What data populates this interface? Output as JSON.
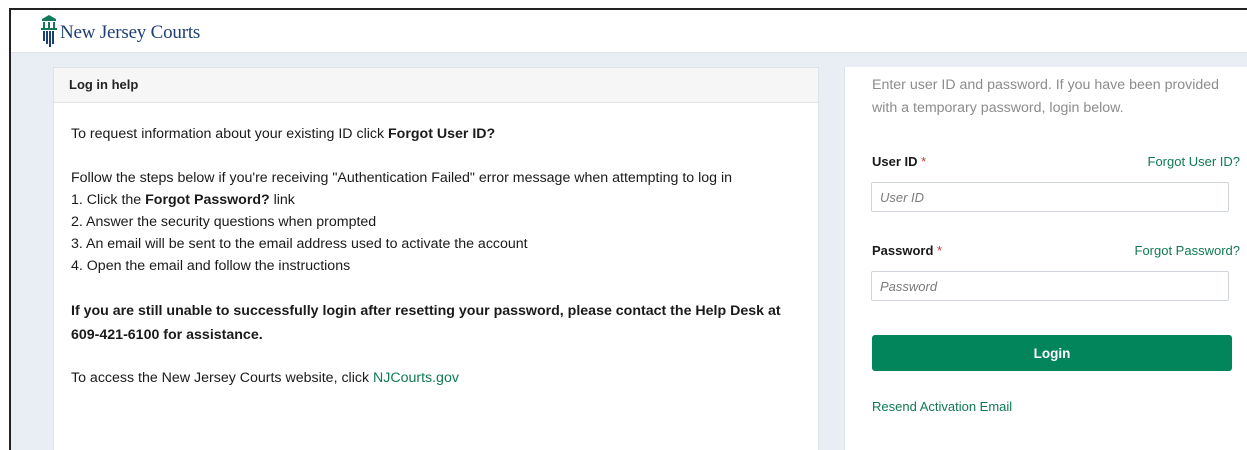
{
  "header": {
    "logo_text": "New Jersey Courts",
    "logo_icon": "courthouse-columns-icon"
  },
  "help": {
    "title": "Log in help",
    "request_text": "To request information about your existing ID click ",
    "request_bold": "Forgot User ID?",
    "follow_text": "Follow the steps below if you're receiving \"Authentication Failed\" error message when attempting to log in",
    "step1_prefix": "1. Click the ",
    "step1_bold": "Forgot Password?",
    "step1_suffix": " link",
    "step2": "2. Answer the security questions when prompted",
    "step3": "3. An email will be sent to the email address used to activate the account",
    "step4": "4. Open the email and follow the instructions",
    "still_unable": "If you are still unable to successfully login after resetting your password, please contact the Help Desk at 609-421-6100 for assistance.",
    "access_text": "To access the New Jersey Courts website, click ",
    "access_link": "NJCourts.gov"
  },
  "login": {
    "intro": "Enter user ID and password. If you have been provided with a temporary password, login below.",
    "userid_label": "User ID",
    "required_mark": "*",
    "forgot_userid": "Forgot User ID?",
    "userid_placeholder": "User ID",
    "userid_value": "",
    "password_label": "Password",
    "forgot_password": "Forgot Password?",
    "password_placeholder": "Password",
    "password_value": "",
    "login_button": "Login",
    "resend_link": "Resend Activation Email"
  },
  "colors": {
    "brand_green": "#03855c",
    "link_green": "#0f7a52",
    "logo_blue": "#1e3f73",
    "required_red": "#c0392b",
    "page_bg": "#e9eef4"
  }
}
